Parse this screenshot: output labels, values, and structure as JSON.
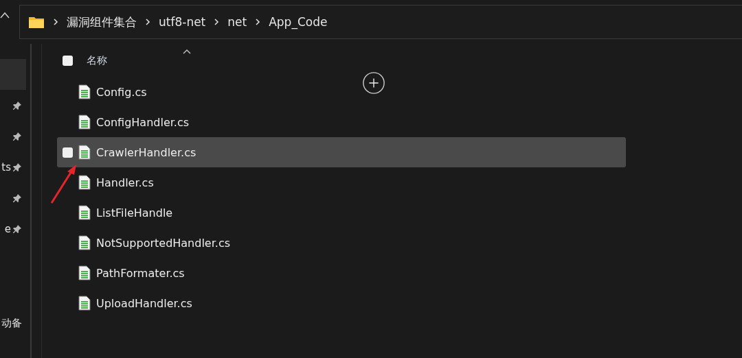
{
  "breadcrumb": [
    "漏洞组件集合",
    "utf8-net",
    "net",
    "App_Code"
  ],
  "sidebar": {
    "items": [
      {
        "pinned": false,
        "selected": true
      },
      {
        "pinned": true,
        "selected": false
      },
      {
        "pinned": true,
        "selected": false
      },
      {
        "label": "ts",
        "pinned": true,
        "selected": false
      },
      {
        "pinned": true,
        "selected": false
      },
      {
        "label": "e",
        "pinned": true,
        "selected": false
      },
      {
        "label": "动备",
        "pinned": false,
        "selected": false
      }
    ]
  },
  "header": {
    "name": "名称",
    "checked": false
  },
  "files": [
    {
      "name": "Config.cs",
      "selected": false
    },
    {
      "name": "ConfigHandler.cs",
      "selected": false
    },
    {
      "name": "CrawlerHandler.cs",
      "selected": true
    },
    {
      "name": "Handler.cs",
      "selected": false
    },
    {
      "name": "ListFileHandle",
      "selected": false
    },
    {
      "name": "NotSupportedHandler.cs",
      "selected": false
    },
    {
      "name": "PathFormater.cs",
      "selected": false
    },
    {
      "name": "UploadHandler.cs",
      "selected": false
    }
  ]
}
